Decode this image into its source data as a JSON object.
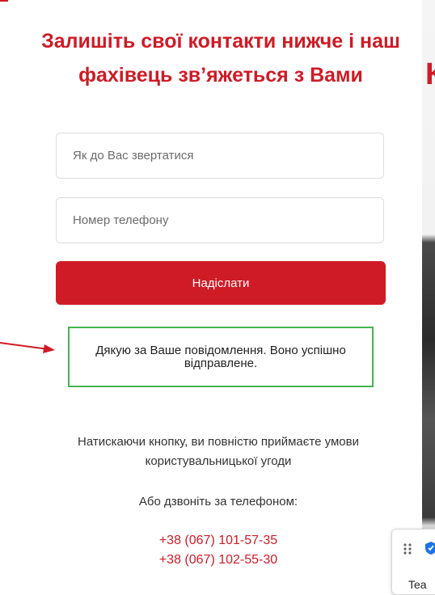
{
  "form": {
    "title": "Залишіть свої контакти нижче і наш фахівець зв’яжеться з Вами",
    "name_placeholder": "Як до Вас звертатися",
    "phone_placeholder": "Номер телефону",
    "submit_label": "Надіслати",
    "success_message": "Дякую за Ваше повідомлення. Воно успішно відправлене.",
    "consent_line1": "Натискаючи кнопку, ви повністю приймаєте умови",
    "consent_line2": "користувальницької угоди",
    "call_label": "Або дзвоніть за телефоном:",
    "phones": [
      "+38 (067) 101-57-35",
      "+38 (067) 102-55-30"
    ]
  },
  "backdrop": {
    "letter": "К"
  },
  "widget": {
    "text": "Tea"
  },
  "colors": {
    "accent": "#cf1b26",
    "success_border": "#46b450",
    "text": "#333333"
  },
  "icons": [
    "arrow-icon",
    "drag-handle-icon",
    "shield-icon"
  ]
}
